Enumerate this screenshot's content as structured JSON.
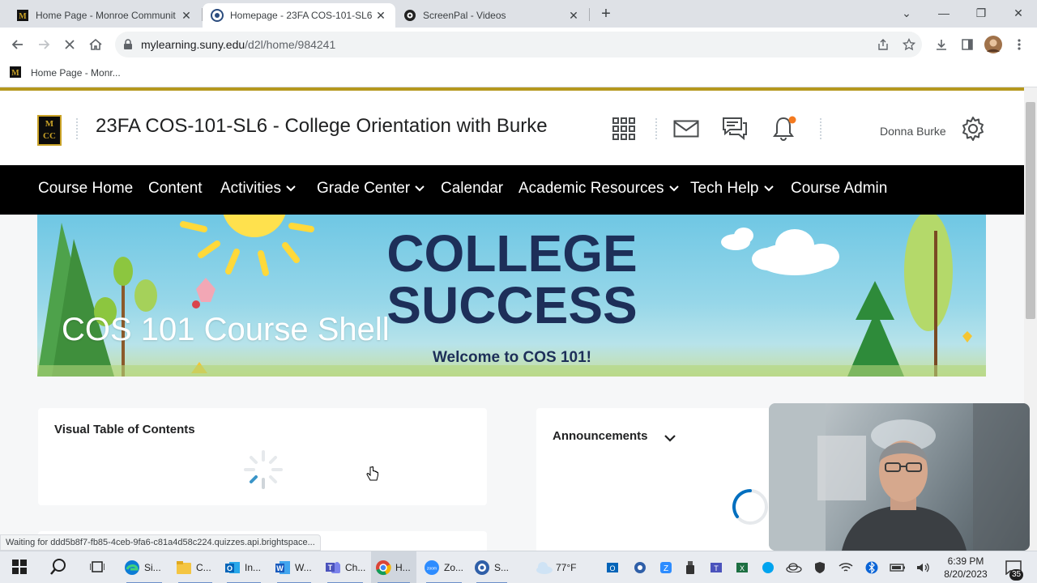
{
  "browser": {
    "tabs": [
      {
        "title": "Home Page - Monroe Communit",
        "active": false
      },
      {
        "title": "Homepage - 23FA COS-101-SL6",
        "active": true
      },
      {
        "title": "ScreenPal - Videos",
        "active": false
      }
    ],
    "new_tab_label": "+",
    "url_host": "mylearning.suny.edu",
    "url_path": "/d2l/home/984241",
    "bookmark_label": "Home Page - Monr..."
  },
  "page": {
    "logo_text_top": "M",
    "logo_text_bottom": "CC",
    "course_title": "23FA COS-101-SL6 - College Orientation with Burke",
    "user_name": "Donna Burke",
    "nav": [
      {
        "label": "Course Home",
        "has_menu": false
      },
      {
        "label": "Content",
        "has_menu": false
      },
      {
        "label": "Activities",
        "has_menu": true
      },
      {
        "label": "Grade Center",
        "has_menu": true
      },
      {
        "label": "Calendar",
        "has_menu": false
      },
      {
        "label": "Academic Resources",
        "has_menu": true
      },
      {
        "label": "Tech Help",
        "has_menu": true
      },
      {
        "label": "Course Admin",
        "has_menu": false
      }
    ],
    "banner": {
      "course_shell": "COS 101 Course Shell",
      "headline_line1": "COLLEGE",
      "headline_line2": "SUCCESS",
      "welcome": "Welcome to COS 101!"
    },
    "widgets": {
      "toc_title": "Visual Table of Contents",
      "announcements_title": "Announcements"
    },
    "status_text": "Waiting for ddd5b8f7-fb85-4ceb-9fa6-c81a4d58c224.quizzes.api.brightspace..."
  },
  "colors": {
    "brand_gold": "#b5981e",
    "nav_bg": "#000000",
    "banner_navy": "#1d2f59",
    "notification_dot": "#f47a1f"
  },
  "taskbar": {
    "items": [
      {
        "label": "Si...",
        "icon": "edge-icon"
      },
      {
        "label": "C...",
        "icon": "file-explorer-icon"
      },
      {
        "label": "In...",
        "icon": "outlook-icon"
      },
      {
        "label": "W...",
        "icon": "word-icon"
      },
      {
        "label": "Ch...",
        "icon": "teams-icon"
      },
      {
        "label": "H...",
        "icon": "chrome-icon"
      },
      {
        "label": "Zo...",
        "icon": "zoom-icon"
      },
      {
        "label": "S...",
        "icon": "screenpal-icon"
      }
    ],
    "weather": "77°F",
    "time": "6:39 PM",
    "date": "8/20/2023",
    "notification_count": "35"
  }
}
